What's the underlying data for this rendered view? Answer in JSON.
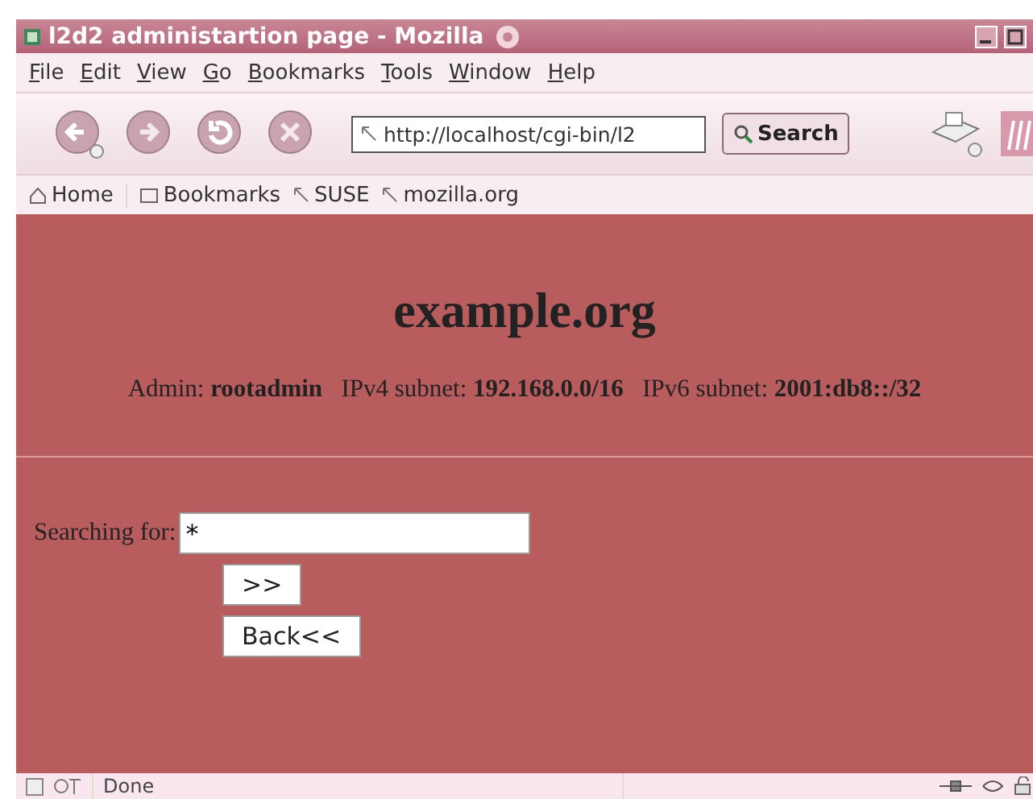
{
  "window": {
    "title": "l2d2 administartion page - Mozilla"
  },
  "menu": [
    "File",
    "Edit",
    "View",
    "Go",
    "Bookmarks",
    "Tools",
    "Window",
    "Help"
  ],
  "toolbar": {
    "address": "http://localhost/cgi-bin/l2",
    "search_button": "Search"
  },
  "bookmarks": [
    {
      "label": "Home",
      "kind": "home"
    },
    {
      "label": "Bookmarks",
      "kind": "folder"
    },
    {
      "label": "SUSE",
      "kind": "link"
    },
    {
      "label": "mozilla.org",
      "kind": "link"
    }
  ],
  "page": {
    "heading": "example.org",
    "info": "Admin: **rootadmin**   IPv4 subnet: **192.168.0.0/16**   IPv6 subnet: **2001:db8::/32**",
    "search_label": "Searching for:",
    "search_value": "*",
    "buttons": [
      ">>",
      "Back<<"
    ]
  },
  "status_bar": {
    "text": "Done"
  }
}
